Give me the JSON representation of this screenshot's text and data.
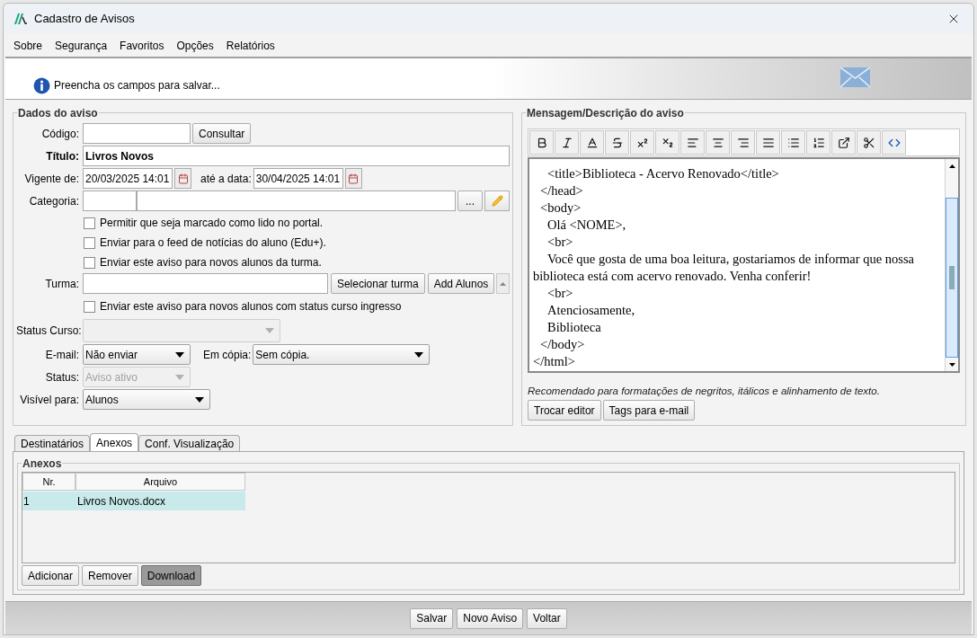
{
  "window": {
    "title": "Cadastro de Avisos"
  },
  "menu": [
    "Sobre",
    "Segurança",
    "Favoritos",
    "Opções",
    "Relatórios"
  ],
  "info": {
    "message": "Preencha os campos para salvar..."
  },
  "dados": {
    "legend": "Dados do aviso",
    "codigo": {
      "label": "Código:",
      "button": "Consultar"
    },
    "titulo": {
      "label": "Título:",
      "value": "Livros Novos"
    },
    "vigente": {
      "label": "Vigente de:",
      "value": "20/03/2025 14:01",
      "until_label": "até a data:",
      "until_value": "30/04/2025 14:01"
    },
    "categoria": {
      "label": "Categoria:",
      "button": "..."
    },
    "checks_top": [
      {
        "label": "Permitir que seja marcado como lido no portal.",
        "checked": false
      },
      {
        "label": "Enviar para o feed de notícias do aluno (Edu+).",
        "checked": false
      },
      {
        "label": "Enviar este aviso para novos alunos da turma.",
        "checked": false
      }
    ],
    "turma": {
      "label": "Turma:",
      "buttons": [
        "Selecionar turma",
        "Add Alunos"
      ]
    },
    "check_ingresso": {
      "label": "Enviar este aviso para novos alunos com status curso ingresso",
      "checked": false
    },
    "status_curso": {
      "label": "Status Curso:",
      "disabled": true
    },
    "email": {
      "label": "E-mail:",
      "value": "Não enviar",
      "disabled": false
    },
    "copia": {
      "label": "Em cópia:",
      "value": "Sem cópia.",
      "disabled": false
    },
    "status": {
      "label": "Status:",
      "value": "Aviso ativo",
      "disabled": true
    },
    "visivel": {
      "label": "Visível para:",
      "value": "Alunos",
      "disabled": false
    }
  },
  "mensagem": {
    "legend": "Mensagem/Descrição do aviso",
    "toolbar": [
      {
        "kind": "bold"
      },
      {
        "kind": "italic"
      },
      {
        "kind": "font-color"
      },
      {
        "kind": "strike"
      },
      {
        "kind": "superscript"
      },
      {
        "kind": "subscript"
      },
      {
        "kind": "align-left"
      },
      {
        "kind": "align-center"
      },
      {
        "kind": "align-right"
      },
      {
        "kind": "justify"
      },
      {
        "kind": "bullets"
      },
      {
        "kind": "numbers"
      },
      {
        "kind": "link"
      },
      {
        "kind": "cut"
      },
      {
        "kind": "source"
      }
    ],
    "lines": [
      {
        "kind": "inner",
        "text": "<title>Biblioteca - Acervo Renovado</title>"
      },
      {
        "kind": "outer",
        "text": "</head>"
      },
      {
        "kind": "outer",
        "text": "<body>"
      },
      {
        "kind": "inner",
        "text": "Olá <NOME>,"
      },
      {
        "kind": "inner",
        "text": "<br>"
      },
      {
        "kind": "paragraph",
        "text": "Você que gosta de uma boa leitura, gostariamos de informar que nossa biblioteca está com acervo renovado. Venha conferir!"
      },
      {
        "kind": "inner",
        "text": "<br>"
      },
      {
        "kind": "inner",
        "text": "Atenciosamente,"
      },
      {
        "kind": "inner",
        "text": "Biblioteca"
      },
      {
        "kind": "outer",
        "text": "</body>"
      },
      {
        "kind": "root",
        "text": "</html>"
      }
    ],
    "note": "Recomendado para formatações de negritos, itálicos e alinhamento de texto.",
    "buttons": [
      "Trocar editor",
      "Tags para e-mail"
    ]
  },
  "tabs": [
    {
      "label": "Destinatários",
      "selected": false
    },
    {
      "label": "Anexos",
      "selected": true
    },
    {
      "label": "Conf. Visualização",
      "selected": false
    }
  ],
  "anexos": {
    "legend": "Anexos",
    "columns": [
      "Nr.",
      "Arquivo"
    ],
    "rows": [
      {
        "cells": [
          "1",
          "Livros Novos.docx"
        ],
        "selected": true
      }
    ],
    "buttons": [
      {
        "label": "Adicionar",
        "pressed": false
      },
      {
        "label": "Remover",
        "pressed": false
      },
      {
        "label": "Download",
        "pressed": true
      }
    ]
  },
  "footer": {
    "buttons": [
      "Salvar",
      "Novo Aviso",
      "Voltar"
    ]
  }
}
